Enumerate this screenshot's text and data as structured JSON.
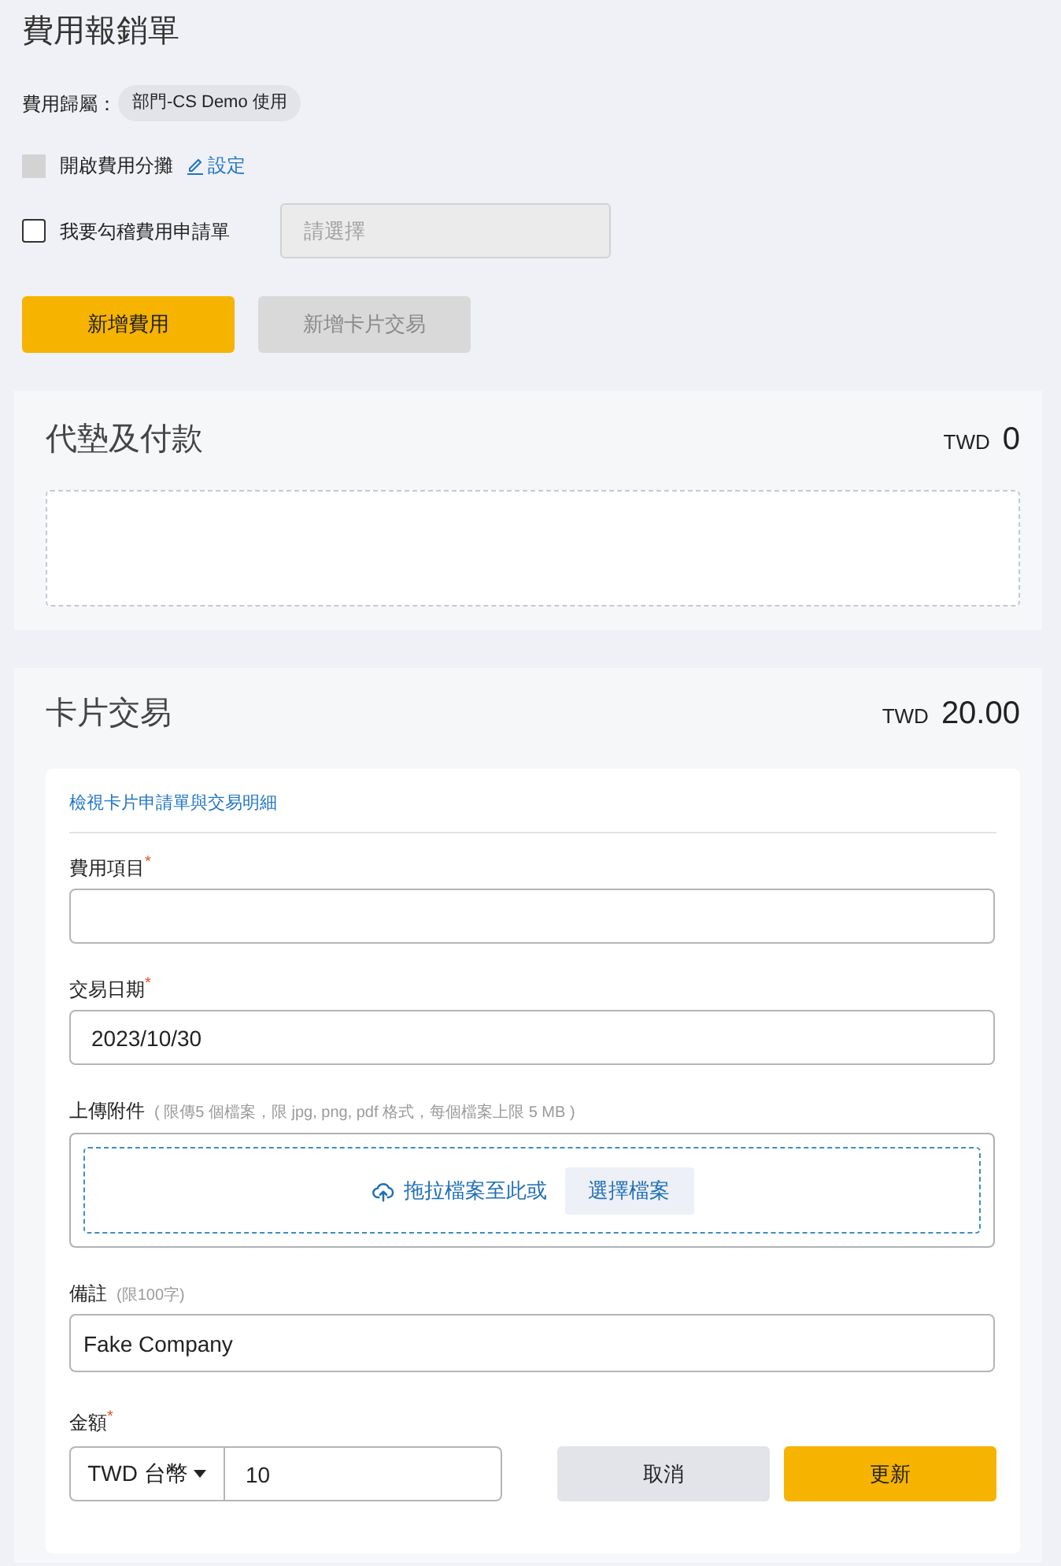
{
  "page": {
    "title": "費用報銷單"
  },
  "expense_owner": {
    "label": "費用歸屬：",
    "value": "部門-CS Demo 使用"
  },
  "options": [
    {
      "kind": "allocation",
      "label": "開啟費用分攤",
      "checked": false,
      "disabled": true,
      "link": "設定"
    },
    {
      "kind": "requisition",
      "label": "我要勾稽費用申請單",
      "checked": false,
      "disabled": false,
      "select": {
        "placeholder": "請選擇",
        "disabled": true
      }
    }
  ],
  "actions": [
    {
      "label": "新增費用",
      "disabled": false
    },
    {
      "label": "新增卡片交易",
      "disabled": true
    }
  ],
  "sections": [
    {
      "kind": "advance",
      "title": "代墊及付款",
      "currency": "TWD",
      "total": "0"
    },
    {
      "kind": "card",
      "title": "卡片交易",
      "currency": "TWD",
      "total": "20.00",
      "form": {
        "link": "檢視卡片申請單與交易明細",
        "fields": [
          {
            "kind": "text",
            "label": "費用項目",
            "required_mark": "*"
          },
          {
            "kind": "text",
            "label": "交易日期",
            "required_mark": "*",
            "value": "2023/10/30"
          },
          {
            "kind": "upload",
            "label": "上傳附件",
            "note": "( 限傳5 個檔案，限 jpg, png, pdf 格式，每個檔案上限 5 MB )",
            "prompt": "拖拉檔案至此或",
            "button": "選擇檔案"
          },
          {
            "kind": "text",
            "label": "備註",
            "note": "(限100字)",
            "value": "Fake Company"
          },
          {
            "kind": "amount",
            "label": "金額",
            "required_mark": "*",
            "currency": "TWD 台幣",
            "value": "10"
          }
        ],
        "buttons": [
          {
            "kind": "secondary",
            "label": "取消"
          },
          {
            "kind": "primary",
            "label": "更新"
          }
        ]
      }
    }
  ]
}
